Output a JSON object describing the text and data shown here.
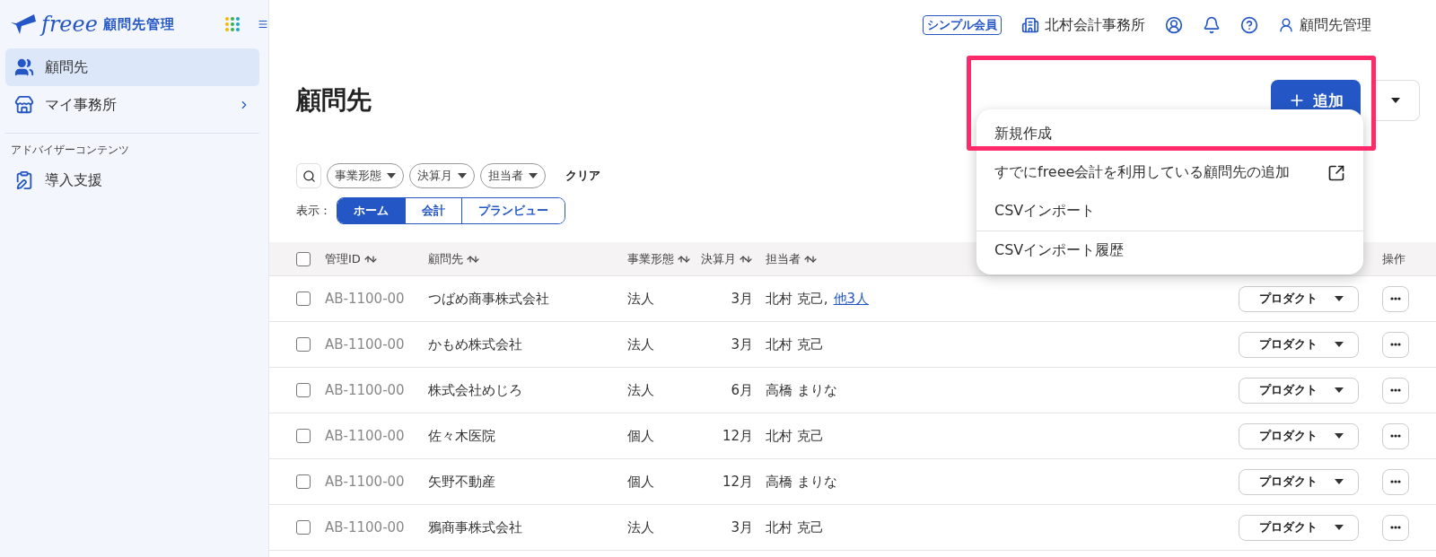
{
  "app": {
    "logo": "freee",
    "product": "顧問先管理"
  },
  "header": {
    "badge": "シンプル会員",
    "office": "北村会計事務所",
    "account": "顧問先管理"
  },
  "sidebar": {
    "items": [
      {
        "label": "顧問先",
        "selected": true,
        "chevron": false
      },
      {
        "label": "マイ事務所",
        "selected": false,
        "chevron": true
      }
    ],
    "section": {
      "title": "アドバイザーコンテンツ",
      "items": [
        {
          "label": "導入支援",
          "selected": false,
          "chevron": false
        }
      ]
    }
  },
  "page": {
    "title": "顧問先",
    "add_button": "追加",
    "add_menu": [
      {
        "label": "新規作成",
        "external": false,
        "divider_before": false,
        "highlighted": true
      },
      {
        "label": "すでにfreee会計を利用している顧問先の追加",
        "external": true,
        "divider_before": false,
        "highlighted": false
      },
      {
        "label": "CSVインポート",
        "external": false,
        "divider_before": false,
        "highlighted": false
      },
      {
        "label": "CSVインポート履歴",
        "external": false,
        "divider_before": true,
        "highlighted": false
      }
    ]
  },
  "filters": {
    "chips": [
      "事業形態",
      "決算月",
      "担当者"
    ],
    "clear": "クリア"
  },
  "view": {
    "label": "表示：",
    "tabs": [
      {
        "label": "ホーム",
        "selected": true
      },
      {
        "label": "会計",
        "selected": false
      },
      {
        "label": "プランビュー",
        "selected": false
      }
    ]
  },
  "table": {
    "header_checked": false,
    "columns": [
      {
        "label": "管理ID",
        "sortable": true
      },
      {
        "label": "顧問先",
        "sortable": true
      },
      {
        "label": "事業形態",
        "sortable": true
      },
      {
        "label": "決算月",
        "sortable": true
      },
      {
        "label": "担当者",
        "sortable": true
      },
      {
        "label": "操作",
        "sortable": false
      }
    ],
    "rows": [
      {
        "checked": false,
        "id": "AB-1100-00",
        "name": "つばめ商事株式会社",
        "type": "法人",
        "month": "3月",
        "person": "北村 克己,",
        "more": "他3人",
        "tag": "プロダクト"
      },
      {
        "checked": false,
        "id": "AB-1100-00",
        "name": "かもめ株式会社",
        "type": "法人",
        "month": "3月",
        "person": "北村 克己",
        "tag": "プロダクト"
      },
      {
        "checked": false,
        "id": "AB-1100-00",
        "name": "株式会社めじろ",
        "type": "法人",
        "month": "6月",
        "person": "高橋 まりな",
        "tag": "プロダクト"
      },
      {
        "checked": false,
        "id": "AB-1100-00",
        "name": "佐々木医院",
        "type": "個人",
        "month": "12月",
        "person": "北村 克己",
        "tag": "プロダクト"
      },
      {
        "checked": false,
        "id": "AB-1100-00",
        "name": "矢野不動産",
        "type": "個人",
        "month": "12月",
        "person": "高橋 まりな",
        "tag": "プロダクト"
      },
      {
        "checked": false,
        "id": "AB-1100-00",
        "name": "鴉商事株式会社",
        "type": "法人",
        "month": "3月",
        "person": "北村 克己",
        "tag": "プロダクト"
      }
    ]
  }
}
